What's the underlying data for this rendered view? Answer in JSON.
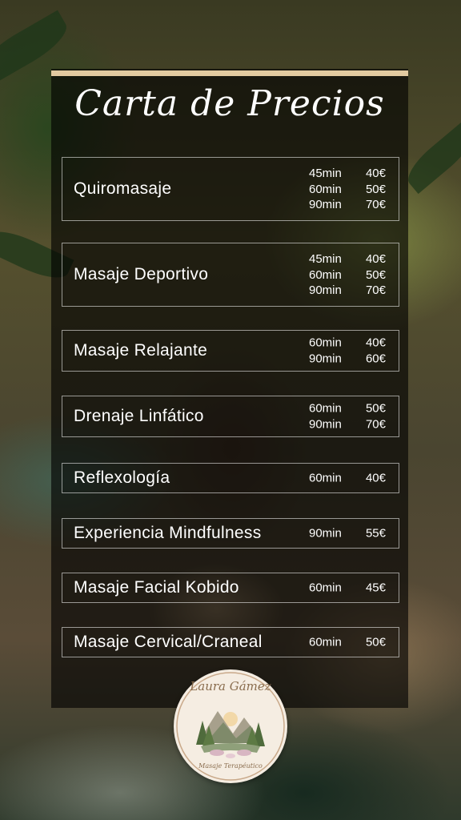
{
  "menu": {
    "title": "Carta de Precios",
    "services": [
      {
        "name": "Quiromasaje",
        "prices": [
          {
            "duration": "45min",
            "price": "40€"
          },
          {
            "duration": "60min",
            "price": "50€"
          },
          {
            "duration": "90min",
            "price": "70€"
          }
        ]
      },
      {
        "name": "Masaje Deportivo",
        "prices": [
          {
            "duration": "45min",
            "price": "40€"
          },
          {
            "duration": "60min",
            "price": "50€"
          },
          {
            "duration": "90min",
            "price": "70€"
          }
        ]
      },
      {
        "name": "Masaje Relajante",
        "prices": [
          {
            "duration": "60min",
            "price": "40€"
          },
          {
            "duration": "90min",
            "price": "60€"
          }
        ]
      },
      {
        "name": "Drenaje Linfático",
        "prices": [
          {
            "duration": "60min",
            "price": "50€"
          },
          {
            "duration": "90min",
            "price": "70€"
          }
        ]
      },
      {
        "name": "Reflexología",
        "prices": [
          {
            "duration": "60min",
            "price": "40€"
          }
        ]
      },
      {
        "name": "Experiencia Mindfulness",
        "prices": [
          {
            "duration": "90min",
            "price": "55€"
          }
        ]
      },
      {
        "name": "Masaje Facial Kobido",
        "prices": [
          {
            "duration": "60min",
            "price": "45€"
          }
        ]
      },
      {
        "name": "Masaje Cervical/Craneal",
        "prices": [
          {
            "duration": "60min",
            "price": "50€"
          }
        ]
      }
    ]
  },
  "logo": {
    "name": "Laura Gámez",
    "subtitle": "Masaje Terapéutico"
  },
  "colors": {
    "accent_bar": "#e2caa0",
    "panel": "rgba(0,0,0,0.62)",
    "text": "#ffffff",
    "logo_text": "#8a6d4e"
  }
}
